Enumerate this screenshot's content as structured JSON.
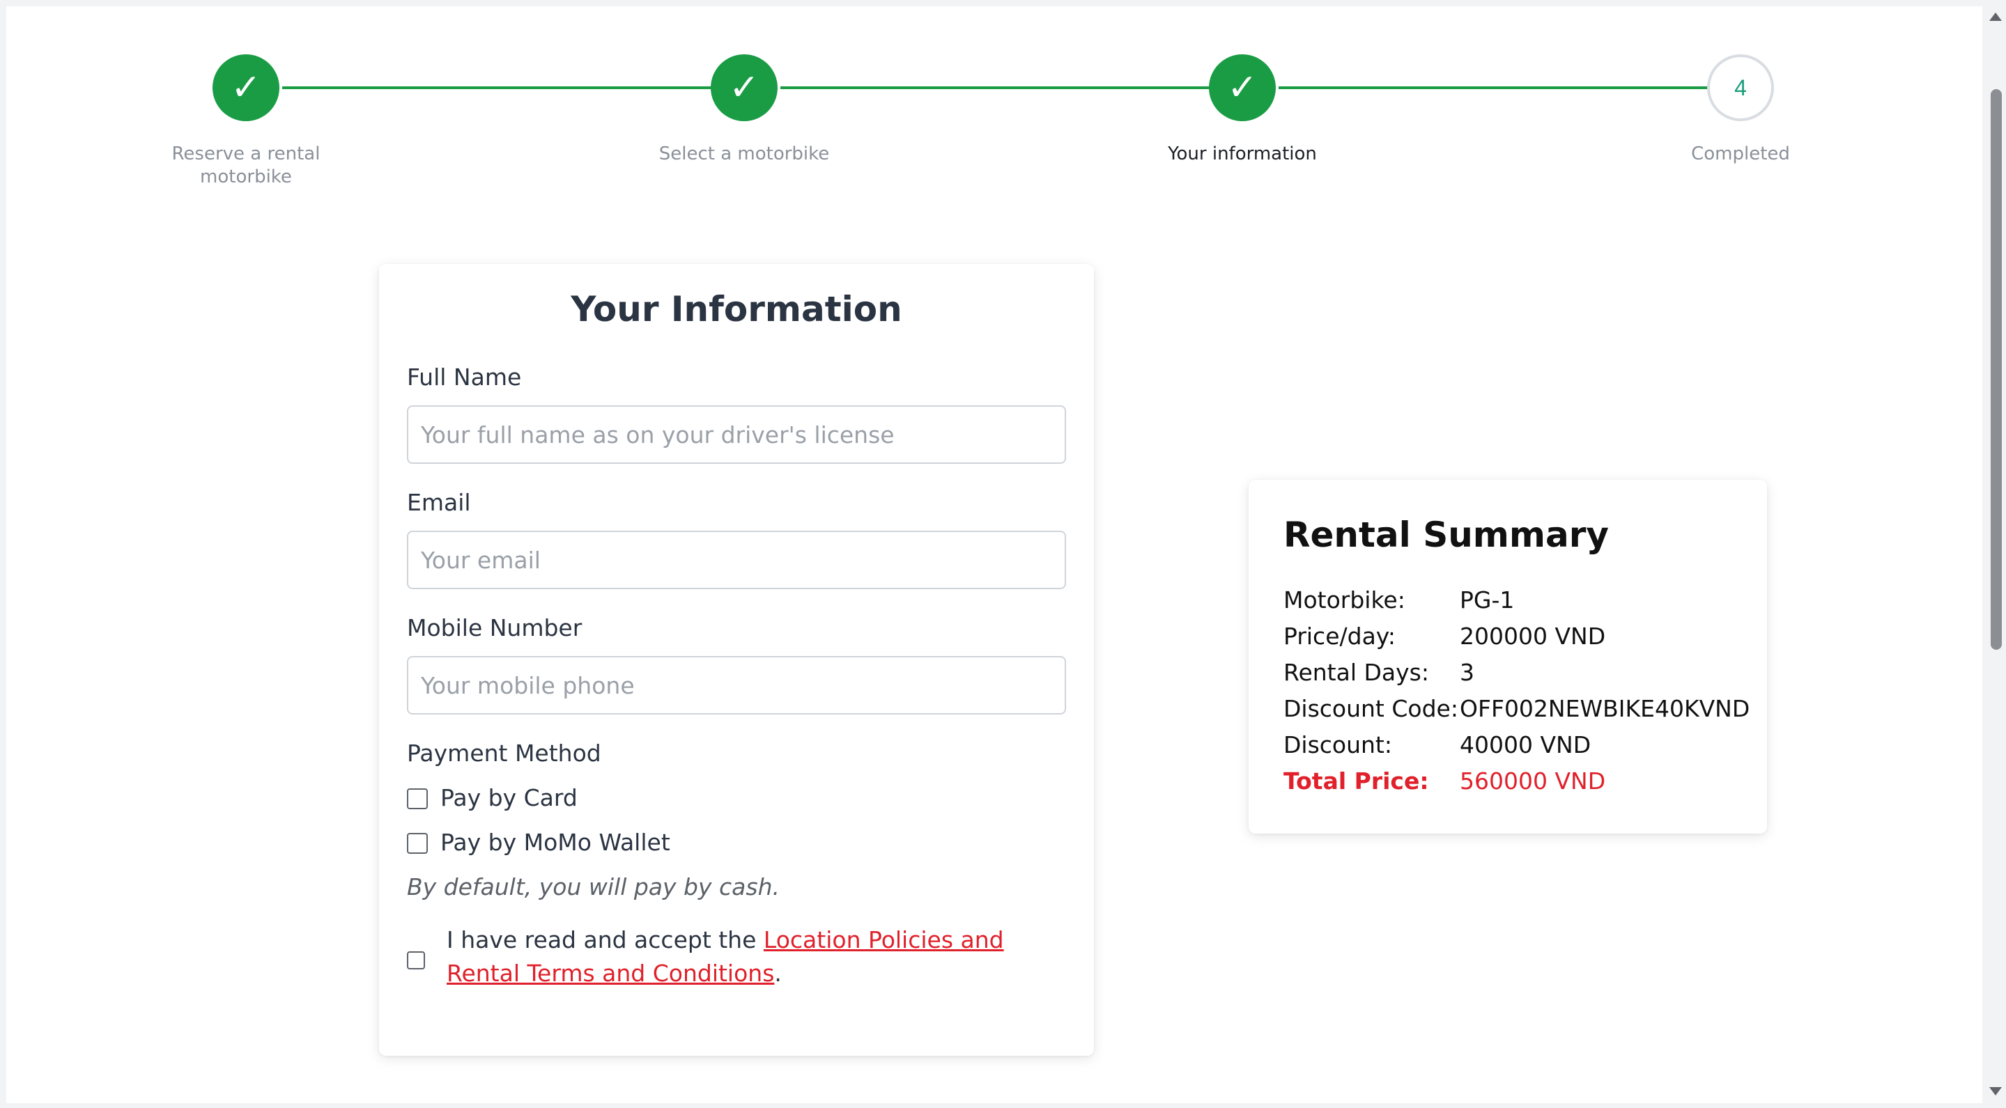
{
  "stepper": {
    "steps": [
      {
        "label": "Reserve a rental motorbike",
        "state": "done",
        "icon": "check-icon"
      },
      {
        "label": "Select a motorbike",
        "state": "done",
        "icon": "check-icon"
      },
      {
        "label": "Your information",
        "state": "active",
        "icon": "check-icon"
      },
      {
        "label": "Completed",
        "state": "pending",
        "number": "4"
      }
    ],
    "check_glyph": "✓"
  },
  "form": {
    "title": "Your Information",
    "full_name": {
      "label": "Full Name",
      "placeholder": "Your full name as on your driver's license",
      "value": ""
    },
    "email": {
      "label": "Email",
      "placeholder": "Your email",
      "value": ""
    },
    "mobile": {
      "label": "Mobile Number",
      "placeholder": "Your mobile phone",
      "value": ""
    },
    "payment": {
      "label": "Payment Method",
      "options": [
        {
          "label": "Pay by Card",
          "checked": false
        },
        {
          "label": "Pay by MoMo Wallet",
          "checked": false
        }
      ],
      "note": "By default, you will pay by cash."
    },
    "terms": {
      "prefix": "I have read and accept the ",
      "link": "Location Policies and Rental Terms and Conditions",
      "suffix": ".",
      "checked": false
    }
  },
  "summary": {
    "title": "Rental Summary",
    "rows": [
      {
        "key": "Motorbike:",
        "value": "PG-1"
      },
      {
        "key": "Price/day:",
        "value": "200000 VND"
      },
      {
        "key": "Rental Days:",
        "value": "3"
      },
      {
        "key": "Discount Code:",
        "value": "OFF002NEWBIKE40KVND"
      },
      {
        "key": "Discount:",
        "value": "40000 VND"
      },
      {
        "key": "Total Price:",
        "value": "560000 VND"
      }
    ]
  },
  "colors": {
    "accent_green": "#1a9c45",
    "total_red": "#e0202a",
    "text_dark": "#2b3442"
  }
}
